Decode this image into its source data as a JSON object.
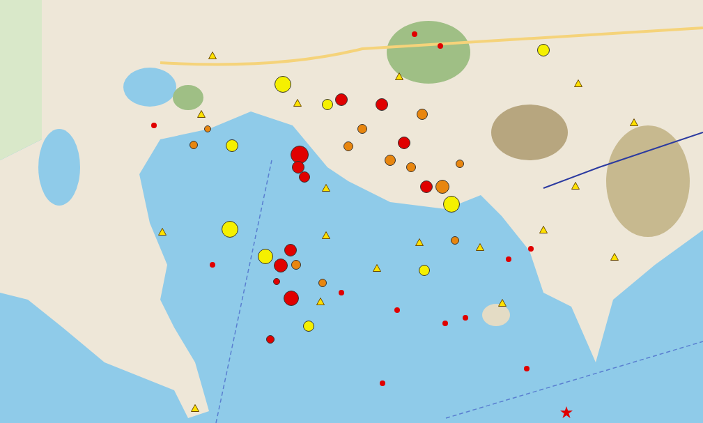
{
  "markers": [
    {
      "kind": "quake",
      "color": "#e00000"
    },
    {
      "kind": "quake",
      "color": "#e00000"
    },
    {
      "kind": "quake",
      "color": "#e00000"
    },
    {
      "kind": "quake",
      "color": "#e00000"
    },
    {
      "kind": "quake",
      "color": "#e00000"
    },
    {
      "kind": "quake",
      "color": "#e00000"
    },
    {
      "kind": "quake",
      "color": "#e00000"
    },
    {
      "kind": "quake",
      "color": "#e00000"
    },
    {
      "kind": "quake",
      "color": "#e00000"
    },
    {
      "kind": "quake",
      "color": "#e00000"
    },
    {
      "kind": "quake",
      "color": "#f5f000"
    },
    {
      "kind": "quake",
      "color": "#f5f000"
    },
    {
      "kind": "quake",
      "color": "#f5f000"
    },
    {
      "kind": "quake",
      "color": "#f5f000"
    },
    {
      "kind": "quake",
      "color": "#f5f000"
    },
    {
      "kind": "quake",
      "color": "#f5f000"
    },
    {
      "kind": "quake",
      "color": "#f5f000"
    },
    {
      "kind": "quake",
      "color": "#f5f000"
    },
    {
      "kind": "quake",
      "color": "#f5f000"
    },
    {
      "kind": "quake",
      "color": "#e8860f"
    },
    {
      "kind": "quake",
      "color": "#e8860f"
    },
    {
      "kind": "quake",
      "color": "#e8860f"
    },
    {
      "kind": "quake",
      "color": "#e8860f"
    },
    {
      "kind": "quake",
      "color": "#e8860f"
    },
    {
      "kind": "quake",
      "color": "#e8860f"
    },
    {
      "kind": "quake",
      "color": "#e8860f"
    },
    {
      "kind": "quake",
      "color": "#e8860f"
    },
    {
      "kind": "quake",
      "color": "#e8860f"
    },
    {
      "kind": "quake",
      "color": "#e8860f"
    },
    {
      "kind": "quake",
      "color": "#e8860f"
    },
    {
      "kind": "quake",
      "color": "#e8860f"
    },
    {
      "kind": "quake",
      "color": "#e00000"
    },
    {
      "kind": "quake",
      "color": "#e00000"
    },
    {
      "kind": "quake",
      "color": "#e00000"
    },
    {
      "kind": "quake",
      "color": "#e00000"
    },
    {
      "kind": "quake",
      "color": "#e00000"
    },
    {
      "kind": "quake",
      "color": "#e00000"
    },
    {
      "kind": "quake",
      "color": "#e00000"
    },
    {
      "kind": "quake",
      "color": "#e00000"
    },
    {
      "kind": "quake",
      "color": "#e00000"
    },
    {
      "kind": "quake",
      "color": "#e00000"
    },
    {
      "kind": "quake",
      "color": "#e00000"
    },
    {
      "kind": "quake",
      "color": "#e00000"
    },
    {
      "kind": "quake",
      "color": "#e00000"
    },
    {
      "kind": "quake",
      "color": "#e00000"
    },
    {
      "kind": "station",
      "color": "#ffe000"
    },
    {
      "kind": "station",
      "color": "#ffe000"
    },
    {
      "kind": "station",
      "color": "#ffe000"
    },
    {
      "kind": "station",
      "color": "#ffe000"
    },
    {
      "kind": "station",
      "color": "#ffe000"
    },
    {
      "kind": "station",
      "color": "#ffe000"
    },
    {
      "kind": "station",
      "color": "#ffe000"
    },
    {
      "kind": "station",
      "color": "#ffe000"
    },
    {
      "kind": "station",
      "color": "#ffe000"
    },
    {
      "kind": "station",
      "color": "#ffe000"
    },
    {
      "kind": "station",
      "color": "#ffe000"
    },
    {
      "kind": "station",
      "color": "#ffe000"
    },
    {
      "kind": "station",
      "color": "#ffe000"
    },
    {
      "kind": "station",
      "color": "#ffe000"
    },
    {
      "kind": "station",
      "color": "#ffe000"
    },
    {
      "kind": "station",
      "color": "#ffe000"
    },
    {
      "kind": "station",
      "color": "#ffe000"
    },
    {
      "kind": "station",
      "color": "#ffe000"
    },
    {
      "kind": "epicenter",
      "color": "#e00000"
    }
  ]
}
